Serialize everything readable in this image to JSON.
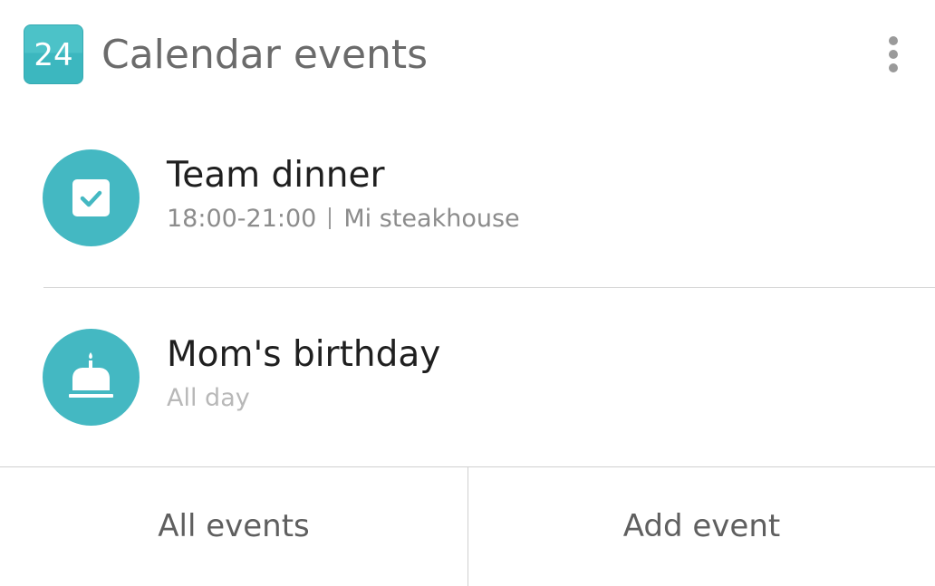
{
  "header": {
    "app_icon_text": "24",
    "title": "Calendar events",
    "menu_icon": "more-vertical-icon"
  },
  "events": [
    {
      "title": "Team dinner",
      "time": "18:00-21:00",
      "location": "Mi steakhouse",
      "icon": "checkbox-icon"
    },
    {
      "title": "Mom's birthday",
      "time": "All day",
      "icon": "birthday-cake-icon"
    }
  ],
  "footer": {
    "all_events_label": "All events",
    "add_event_label": "Add event"
  },
  "colors": {
    "accent": "#44b8c2",
    "title_text": "#1f1f1f",
    "secondary_text": "#8c8c8c",
    "header_text": "#6b6b6b"
  }
}
